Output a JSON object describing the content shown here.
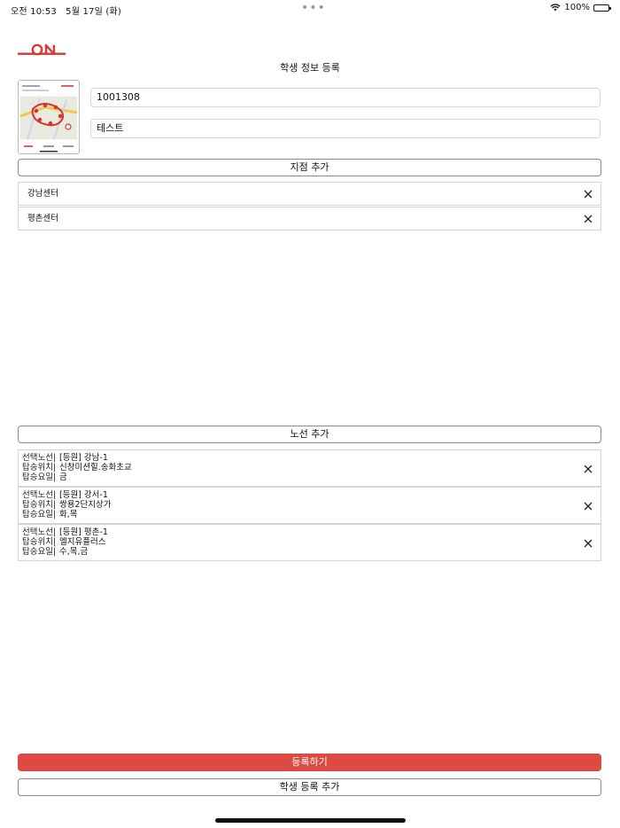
{
  "status_bar": {
    "time": "오전 10:53",
    "date": "5월 17일 (화)",
    "battery": "100%"
  },
  "header": {
    "title": "학생 정보 등록"
  },
  "student": {
    "id_value": "1001308",
    "name_value": "테스트"
  },
  "branch": {
    "add_label": "지점 추가",
    "items": [
      {
        "name": "강남센터"
      },
      {
        "name": "평촌센터"
      }
    ]
  },
  "route": {
    "add_label": "노선 추가",
    "field_labels": {
      "route": "선택노선|",
      "location": "탑승위치|",
      "days": "탑승요일|"
    },
    "items": [
      {
        "route": "[등원] 강남-1",
        "location": "신창미션힐.송화초교",
        "days": "금"
      },
      {
        "route": "[등원] 강서-1",
        "location": "쌍용2단지상가",
        "days": "화,목"
      },
      {
        "route": "[등원] 평촌-1",
        "location": "엘지유플러스",
        "days": "수,목,금"
      }
    ]
  },
  "actions": {
    "register_label": "등록하기",
    "add_student_label": "학생 등록 추가"
  },
  "colors": {
    "accent": "#dd4a42",
    "border": "#d5d5d5"
  },
  "icons": {
    "remove": "close-icon",
    "wifi": "wifi-icon",
    "battery": "battery-icon"
  }
}
